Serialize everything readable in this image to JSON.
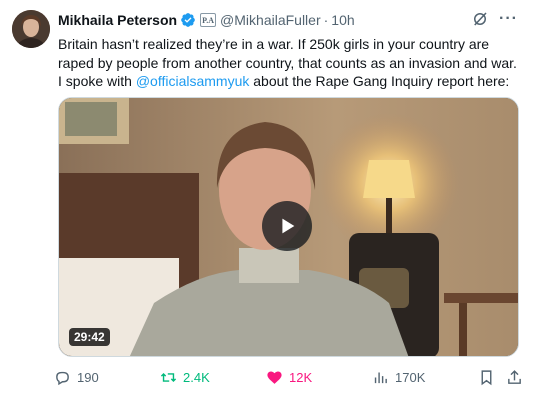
{
  "author": {
    "name": "Mikhaila Peterson",
    "affiliate_badge": "P.A",
    "handle": "@MikhailaFuller",
    "time": "10h"
  },
  "tweet": {
    "text_before": "Britain hasn’t realized they’re in a war. If 250k girls in your country are raped by people from another country, that counts as an invasion and war. I spoke with ",
    "mention": "@officialsammyuk",
    "text_after": " about the Rape Gang Inquiry report here:"
  },
  "video": {
    "duration": "29:42"
  },
  "actions": {
    "replies": "190",
    "reposts": "2.4K",
    "likes": "12K",
    "views": "170K"
  },
  "colors": {
    "accent": "#1d9bf0",
    "repost_active": "#00ba7c",
    "like_active": "#f91880",
    "secondary_text": "#536471"
  }
}
